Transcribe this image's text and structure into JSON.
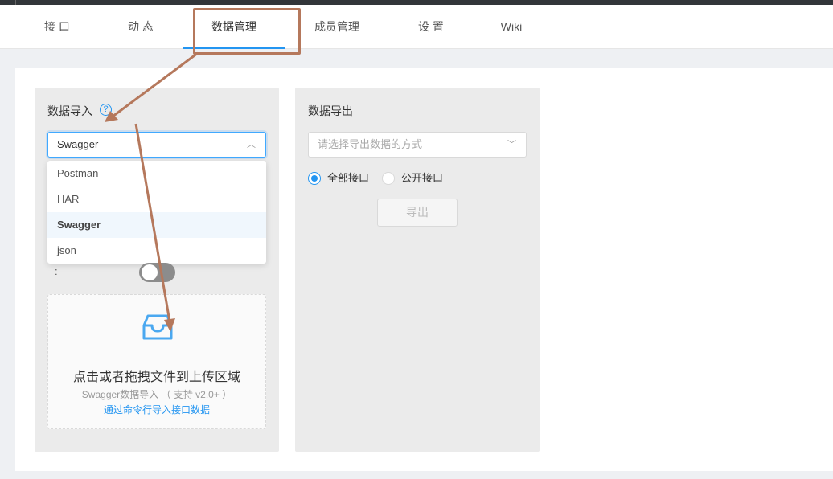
{
  "nav": {
    "tabs": [
      "接 口",
      "动 态",
      "数据管理",
      "成员管理",
      "设 置",
      "Wiki"
    ],
    "active_index": 2
  },
  "import_panel": {
    "title": "数据导入",
    "help_icon": "question-circle-icon",
    "select_value": "Swagger",
    "dropdown_options": [
      "Postman",
      "HAR",
      "Swagger",
      "json"
    ],
    "selected_option": "Swagger",
    "toggle_label": ":",
    "toggle_on": false,
    "upload": {
      "icon": "inbox-icon",
      "main_text": "点击或者拖拽文件到上传区域",
      "hint_text": "Swagger数据导入 （ 支持 v2.0+ ）",
      "link_text": "通过命令行导入接口数据"
    }
  },
  "export_panel": {
    "title": "数据导出",
    "select_placeholder": "请选择导出数据的方式",
    "radios": [
      {
        "label": "全部接口",
        "checked": true
      },
      {
        "label": "公开接口",
        "checked": false
      }
    ],
    "button_label": "导出"
  },
  "colors": {
    "accent": "#2395f1",
    "annotation": "#b5785c"
  }
}
